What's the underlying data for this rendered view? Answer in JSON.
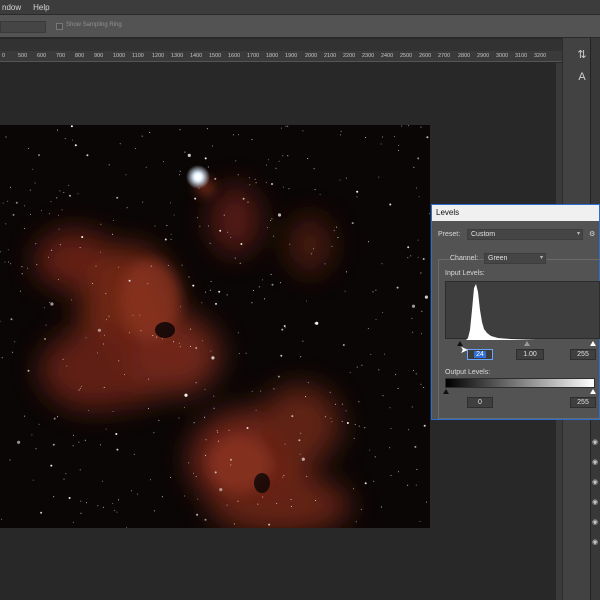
{
  "menu": {
    "window_label": "ndow",
    "help_label": "Help"
  },
  "options": {
    "sampling_ring_label": "Show Sampling Ring"
  },
  "ruler": {
    "ticks": [
      "0",
      "500",
      "600",
      "700",
      "800",
      "900",
      "1000",
      "1100",
      "1200",
      "1300",
      "1400",
      "1500",
      "1600",
      "1700",
      "1800",
      "1900",
      "2000",
      "2100",
      "2200",
      "2300",
      "2400",
      "2500",
      "2600",
      "2700",
      "2800",
      "2900",
      "3000",
      "3100",
      "3200"
    ]
  },
  "levels": {
    "title": "Levels",
    "preset_label": "Preset:",
    "preset_value": "Custom",
    "channel_label": "Channel:",
    "channel_value": "Green",
    "input_levels_label": "Input Levels:",
    "input_black": "24",
    "input_gamma": "1.00",
    "input_white": "255",
    "output_levels_label": "Output Levels:",
    "output_black": "0",
    "output_white": "255"
  },
  "icons": {
    "gear": "gear-icon",
    "eye": "eye-icon",
    "type_tool": "A"
  },
  "colors": {
    "accent": "#2a6fd0",
    "nebula": "#8a2f1c",
    "histogram": "#ffffff"
  }
}
